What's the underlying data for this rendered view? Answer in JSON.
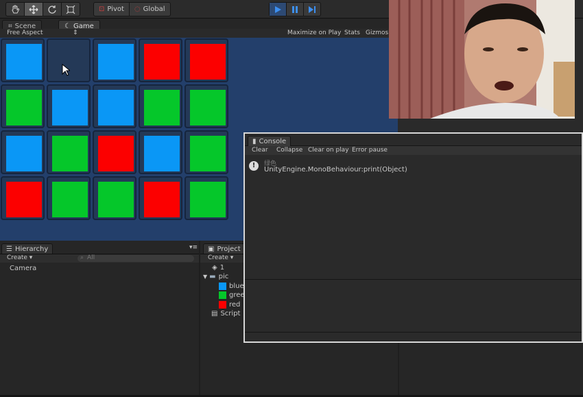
{
  "toolbar": {
    "tools": [
      "hand-icon",
      "move-icon",
      "rotate-icon",
      "scale-icon"
    ],
    "pivot_label": "Pivot",
    "global_label": "Global",
    "play": [
      "play-icon",
      "pause-icon",
      "step-icon"
    ]
  },
  "scene_tabs": {
    "scene": "Scene",
    "game": "Game"
  },
  "game_bar": {
    "aspect": "Free Aspect",
    "maximize": "Maximize on Play",
    "stats": "Stats",
    "gizmos": "Gizmos"
  },
  "grid": [
    [
      "blue",
      "empty",
      "blue",
      "red",
      "red"
    ],
    [
      "green",
      "blue",
      "blue",
      "green",
      "green"
    ],
    [
      "blue",
      "green",
      "red",
      "blue",
      "green"
    ],
    [
      "red",
      "green",
      "green",
      "red",
      "green"
    ]
  ],
  "colors": {
    "blue": "#0a97f6",
    "green": "#05c72a",
    "red": "#fc0000",
    "background": "#233f6b",
    "empty_cell": "#243957"
  },
  "hierarchy": {
    "title": "Hierarchy",
    "create": "Create ▾",
    "search": "All",
    "items": [
      "Camera"
    ]
  },
  "project": {
    "title": "Project",
    "create": "Create ▾",
    "items": {
      "scene": "1",
      "folder": "pic",
      "blue": "blue",
      "green": "green",
      "red": "red",
      "script": "Script"
    }
  },
  "console": {
    "title": "Console",
    "buttons": {
      "clear": "Clear",
      "collapse": "Collapse",
      "clear_on_play": "Clear on play",
      "error_pause": "Error pause"
    },
    "message_line1": "绿色",
    "message_line2": "UnityEngine.MonoBehaviour:print(Object)"
  }
}
